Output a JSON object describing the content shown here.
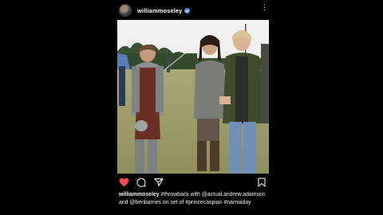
{
  "post": {
    "username": "williammoseley",
    "verified": true,
    "caption_user": "williammoseley",
    "caption_text": "#throwback with @actual.andrew.adamson and @benbarnes on set of #princecaspian #narniaday"
  },
  "icons": {
    "more": "more-options-icon",
    "like": "heart-icon",
    "comment": "comment-icon",
    "share": "send-icon",
    "save": "bookmark-icon"
  },
  "colors": {
    "background": "#000000",
    "like_active": "#ed4956",
    "verified": "#3897f0"
  }
}
